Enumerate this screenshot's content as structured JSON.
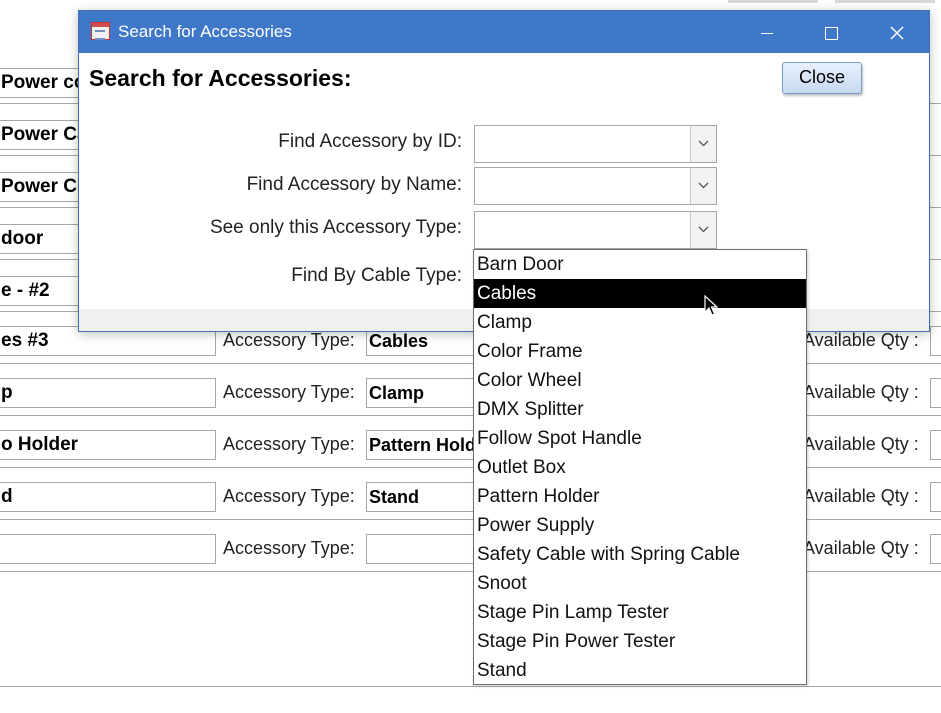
{
  "dialog": {
    "title": "Search for Accessories",
    "heading": "Search for Accessories:",
    "close_label": "Close",
    "fields": {
      "by_id_label": "Find Accessory by ID:",
      "by_name_label": "Find Accessory by Name:",
      "by_type_label": "See only this Accessory Type:",
      "by_cable_label": "Find By Cable Type:"
    }
  },
  "dropdown": {
    "items": [
      "Barn Door",
      "Cables",
      "Clamp",
      "Color Frame",
      "Color Wheel",
      "DMX Splitter",
      "Follow Spot Handle",
      "Outlet Box",
      "Pattern Holder",
      "Power Supply",
      "Safety Cable with Spring Cable",
      "Snoot",
      "Stage Pin Lamp Tester",
      "Stage Pin Power Tester",
      "Stand"
    ],
    "selected": "Cables"
  },
  "background_form": {
    "accessory_type_label": "Accessory Type:",
    "available_qty_label": "Available Qty :",
    "rows": [
      {
        "name": "Power co",
        "type": ""
      },
      {
        "name": "Power Ca",
        "type": ""
      },
      {
        "name": "Power Co",
        "type": ""
      },
      {
        "name": "door",
        "type": ""
      },
      {
        "name": "e - #2",
        "type": ""
      },
      {
        "name": "es #3",
        "type": "Cables"
      },
      {
        "name": "p",
        "type": "Clamp"
      },
      {
        "name": "o Holder",
        "type": "Pattern Hold"
      },
      {
        "name": "d",
        "type": "Stand"
      },
      {
        "name": "",
        "type": ""
      }
    ]
  },
  "colors": {
    "titlebar": "#3f78c9",
    "selection": "#000000",
    "close_button": "#c6d9f1"
  }
}
